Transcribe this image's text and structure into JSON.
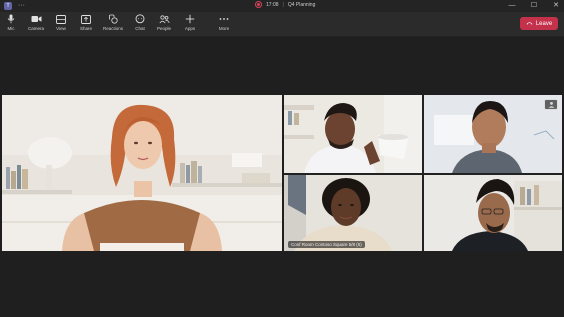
{
  "titlebar": {
    "app_icon": "teams-logo-icon",
    "more_label": "···",
    "timer": "17:08",
    "separator": "|",
    "meeting_title": "Q4 Planning",
    "controls": [
      "—",
      "☐",
      "✕"
    ]
  },
  "toolbar": {
    "items": [
      {
        "label": "Mic",
        "icon": "mic-icon"
      },
      {
        "label": "Camera",
        "icon": "camera-icon"
      },
      {
        "label": "View",
        "icon": "view-icon"
      },
      {
        "label": "Share",
        "icon": "share-icon"
      },
      {
        "label": "Reactions",
        "icon": "reactions-icon"
      },
      {
        "label": "Chat",
        "icon": "chat-icon"
      },
      {
        "label": "People",
        "icon": "people-icon"
      },
      {
        "label": "Apps",
        "icon": "apps-icon"
      },
      {
        "label": "More",
        "icon": "more-icon"
      }
    ],
    "leave_label": "Leave"
  },
  "participants": {
    "main_name": "",
    "room_label": "Conf Room Contoso Square 5/8 (5)"
  },
  "colors": {
    "leave": "#c4314b",
    "background": "#1f1f1f",
    "toolbar": "#2b2b2b"
  }
}
